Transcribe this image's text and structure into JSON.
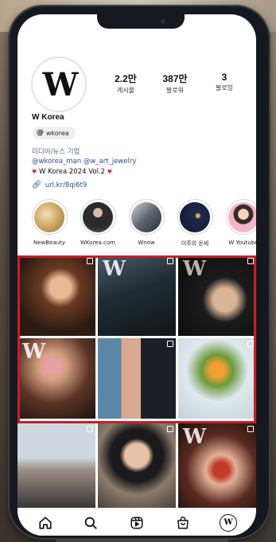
{
  "profile": {
    "avatar_letter": "W",
    "name": "W Korea",
    "stats": [
      {
        "value": "2.2만",
        "label": "게시물"
      },
      {
        "value": "387만",
        "label": "팔로워"
      },
      {
        "value": "3",
        "label": "팔로잉"
      }
    ],
    "threads_badge": "wkorea",
    "category": "미디어/뉴스 기업",
    "tags": "@wkorea_man @w_art_jewelry",
    "bio_line": "W Korea 2024 Vol.2",
    "bio_heart": "♥",
    "link": "url.kr/8qi6t9"
  },
  "highlights": [
    {
      "label": "NewBeauty",
      "color": "#c9a15a"
    },
    {
      "label": "WKorea.com",
      "color": "#3a3a3a"
    },
    {
      "label": "Wnow",
      "color": "#5c6570"
    },
    {
      "label": "이주의 운세",
      "color": "#1f2a4a"
    },
    {
      "label": "W Youtube",
      "color": "#e8a0b0"
    }
  ],
  "grid_logo": "W",
  "nav": {
    "home_icon": "home-icon",
    "search_icon": "search-icon",
    "reels_icon": "reels-icon",
    "shop_icon": "shop-icon",
    "profile_letter": "W"
  },
  "colors": {
    "accent_link": "#2f4d8a",
    "highlight_border": "#c81f26"
  }
}
